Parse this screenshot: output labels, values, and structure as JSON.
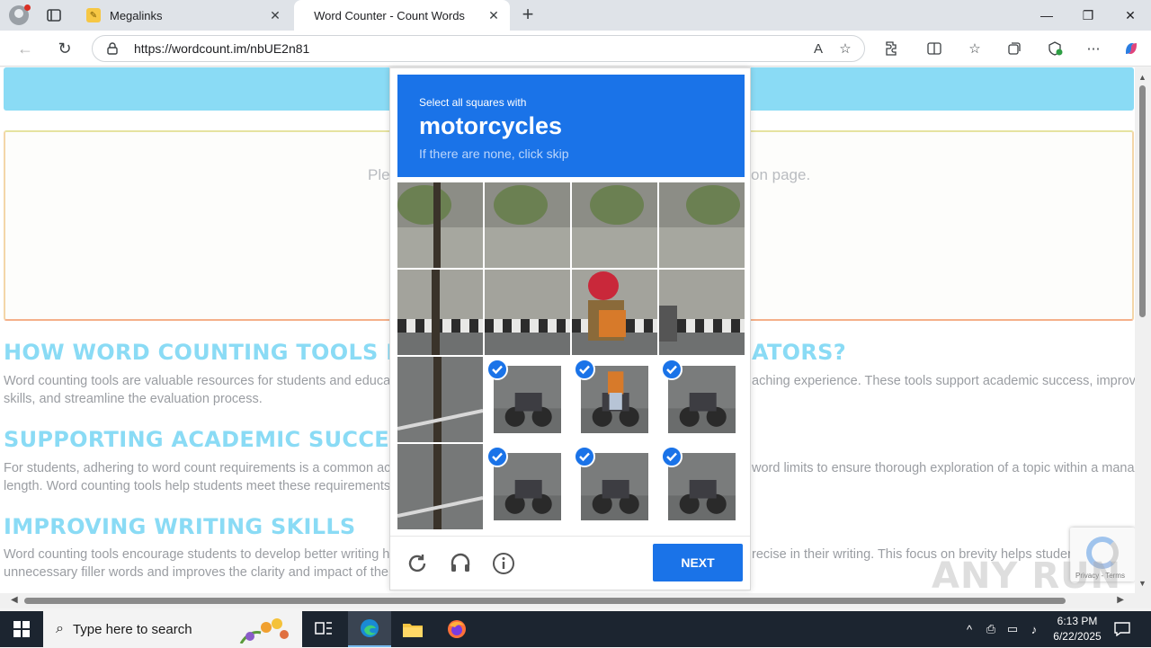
{
  "browser": {
    "tabs": [
      {
        "title": "Megalinks",
        "active": false
      },
      {
        "title": "Word Counter - Count Words",
        "active": true
      }
    ],
    "url": "https://wordcount.im/nbUE2n81",
    "window_controls": {
      "minimize": "—",
      "restore": "❐",
      "close": "✕"
    }
  },
  "page": {
    "placeholder_left": "Ple",
    "placeholder_right": "on page.",
    "headings": {
      "h1": "HOW WORD COUNTING TOOLS B",
      "h1_tail": "ATORS?",
      "h2": "SUPPORTING ACADEMIC SUCCE",
      "h3": "IMPROVING WRITING SKILLS"
    },
    "paragraphs": {
      "p1_line1_left": "Word counting tools are valuable resources for students and educator",
      "p1_line1_right": "aching experience. These tools support academic success, improve w",
      "p1_line2": "skills, and streamline the evaluation process.",
      "p2_line1_left": "For students, adhering to word count requirements is a common acad",
      "p2_line1_right": "word limits to ensure thorough exploration of a topic within a manage",
      "p2_line2": "length. Word counting tools help students meet these requirements, e",
      "p3_line1_left": "Word counting tools encourage students to develop better writing hab",
      "p3_line1_right": "recise in their writing. This focus on brevity helps students",
      "p3_line2": "unnecessary filler words and improves the clarity and impact of their w"
    },
    "recaptcha_links": "Privacy - Terms",
    "watermark": "ANY RUN"
  },
  "challenge": {
    "instruction": "Select all squares with",
    "target": "motorcycles",
    "hint": "If there are none, click skip",
    "next_label": "NEXT",
    "tiles": [
      {
        "index": 0,
        "selected": false
      },
      {
        "index": 1,
        "selected": false
      },
      {
        "index": 2,
        "selected": false
      },
      {
        "index": 3,
        "selected": false
      },
      {
        "index": 4,
        "selected": false
      },
      {
        "index": 5,
        "selected": false
      },
      {
        "index": 6,
        "selected": false
      },
      {
        "index": 7,
        "selected": false
      },
      {
        "index": 8,
        "selected": false
      },
      {
        "index": 9,
        "selected": true
      },
      {
        "index": 10,
        "selected": true
      },
      {
        "index": 11,
        "selected": true
      },
      {
        "index": 12,
        "selected": false
      },
      {
        "index": 13,
        "selected": true
      },
      {
        "index": 14,
        "selected": true
      },
      {
        "index": 15,
        "selected": true
      }
    ],
    "accent_color": "#1a73e8"
  },
  "taskbar": {
    "search_placeholder": "Type here to search",
    "time": "6:13 PM",
    "date": "6/22/2025"
  }
}
